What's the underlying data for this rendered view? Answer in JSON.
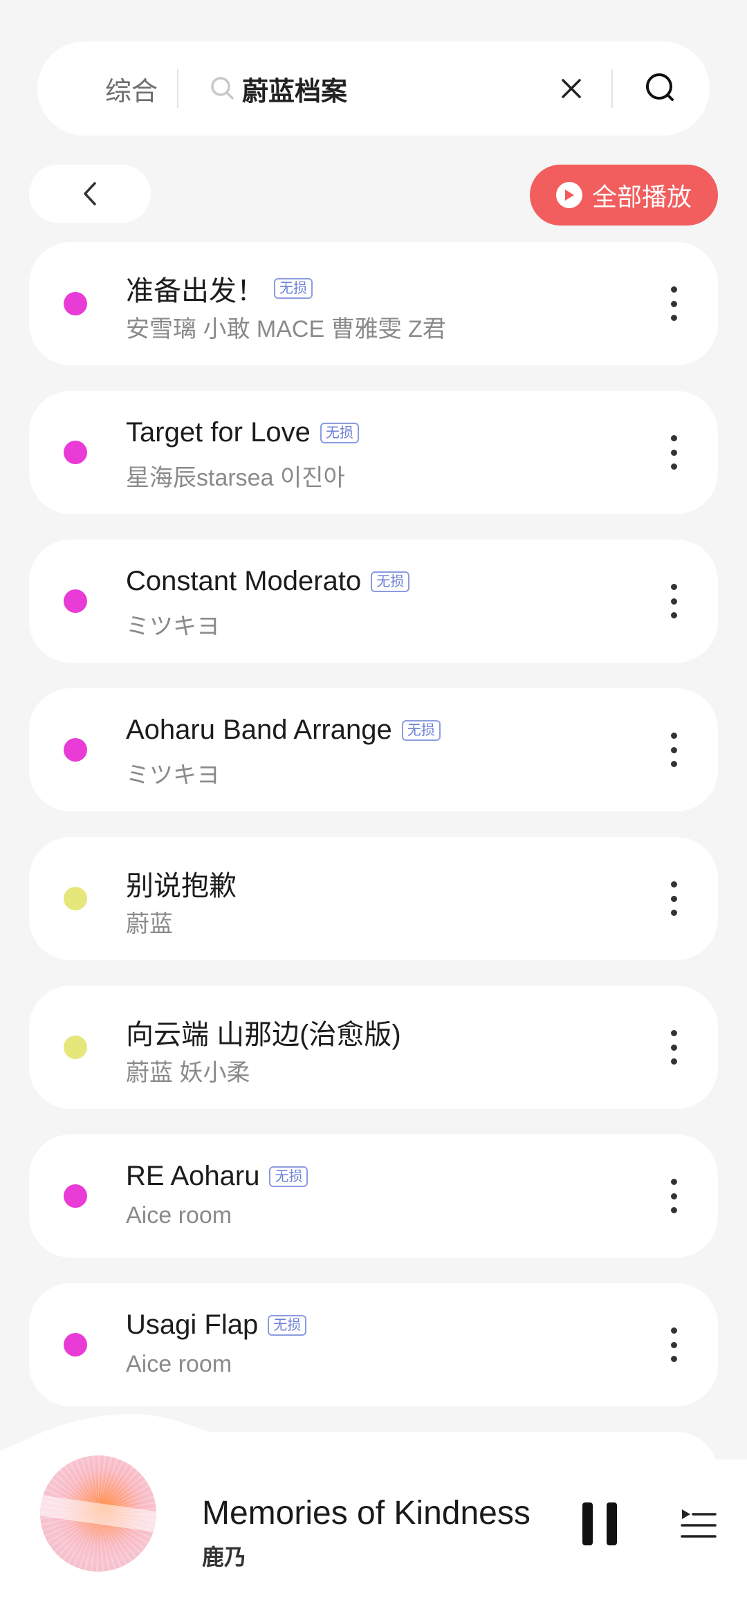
{
  "search": {
    "type_label": "综合",
    "query": "蔚蓝档案"
  },
  "controls": {
    "play_all_label": "全部播放"
  },
  "songs": [
    {
      "title": "准备出发！",
      "lossless": "无损",
      "artist": "安雪璃 小敢 MACE 曹雅雯 Z君",
      "dot_color": "#e93bd6"
    },
    {
      "title": "Target for Love",
      "lossless": "无损",
      "artist": "星海辰starsea 이진아",
      "dot_color": "#e93bd6"
    },
    {
      "title": "Constant Moderato",
      "lossless": "无损",
      "artist": "ミツキヨ",
      "dot_color": "#e93bd6"
    },
    {
      "title": "Aoharu Band Arrange",
      "lossless": "无损",
      "artist": "ミツキヨ",
      "dot_color": "#e93bd6"
    },
    {
      "title": "别说抱歉",
      "lossless": "",
      "artist": "蔚蓝",
      "dot_color": "#e6e77a"
    },
    {
      "title": "向云端 山那边(治愈版)",
      "lossless": "",
      "artist": "蔚蓝 妖小柔",
      "dot_color": "#e6e77a"
    },
    {
      "title": "RE Aoharu",
      "lossless": "无损",
      "artist": "Aice room",
      "dot_color": "#e93bd6"
    },
    {
      "title": "Usagi Flap",
      "lossless": "无损",
      "artist": "Aice room",
      "dot_color": "#e93bd6"
    }
  ],
  "player": {
    "title": "Memories of Kindness",
    "artist": "鹿乃",
    "state": "playing"
  },
  "icons": {
    "search": "search-icon",
    "clear": "close-icon",
    "back": "chevron-left-icon",
    "play": "play-circle-icon",
    "more": "more-vertical-icon",
    "pause": "pause-icon",
    "playlist": "playlist-icon"
  }
}
